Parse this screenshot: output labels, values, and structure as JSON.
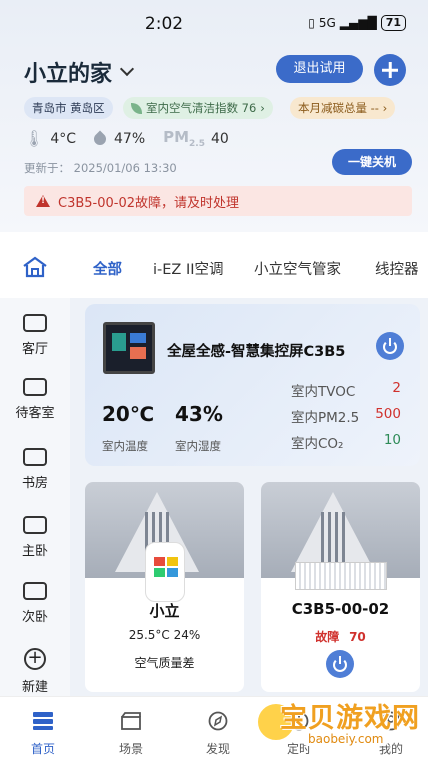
{
  "status_bar": {
    "time": "2:02",
    "network": "5G",
    "battery": "71"
  },
  "header": {
    "home_name": "小立的家",
    "exit_trial": "退出试用",
    "location": "青岛市 黄岛区",
    "air_index": "室内空气清洁指数 76",
    "carbon": "本月减碳总量 --",
    "temperature": "4°C",
    "humidity": "47%",
    "pm_label": "PM",
    "pm_sub": "2.5",
    "pm_value": "40",
    "updated": "更新于： 2025/01/06 13:30",
    "one_key_off": "一键关机",
    "alert": "C3B5-00-02故障，请及时处理"
  },
  "tabs": [
    "全部",
    "i-EZ II空调",
    "小立空气管家",
    "线控器"
  ],
  "rooms": [
    "客厅",
    "待客室",
    "书房",
    "主卧",
    "次卧",
    "新建"
  ],
  "panel_card": {
    "title": "全屋全感-智慧集控屏C3B5",
    "temp_value": "20℃",
    "temp_label": "室内温度",
    "hum_value": "43%",
    "hum_label": "室内湿度",
    "tvoc_label": "室内TVOC",
    "tvoc_value": "2",
    "pm_label": "室内PM2.5",
    "pm_value": "500",
    "co2_label": "室内CO₂",
    "co2_value": "10"
  },
  "devices": [
    {
      "name": "小立",
      "sub": "25.5°C  24%",
      "sub2": "空气质量差"
    },
    {
      "name": "C3B5-00-02",
      "status": "故障",
      "status_value": "70"
    }
  ],
  "bottom_nav": [
    "首页",
    "场景",
    "发现",
    "定时",
    "我的"
  ],
  "watermark": {
    "title": "宝贝游戏网",
    "url": "baobeiy.com"
  },
  "colors": {
    "accent": "#3b6bc9",
    "error": "#d0312d",
    "ok": "#2e8b57"
  }
}
